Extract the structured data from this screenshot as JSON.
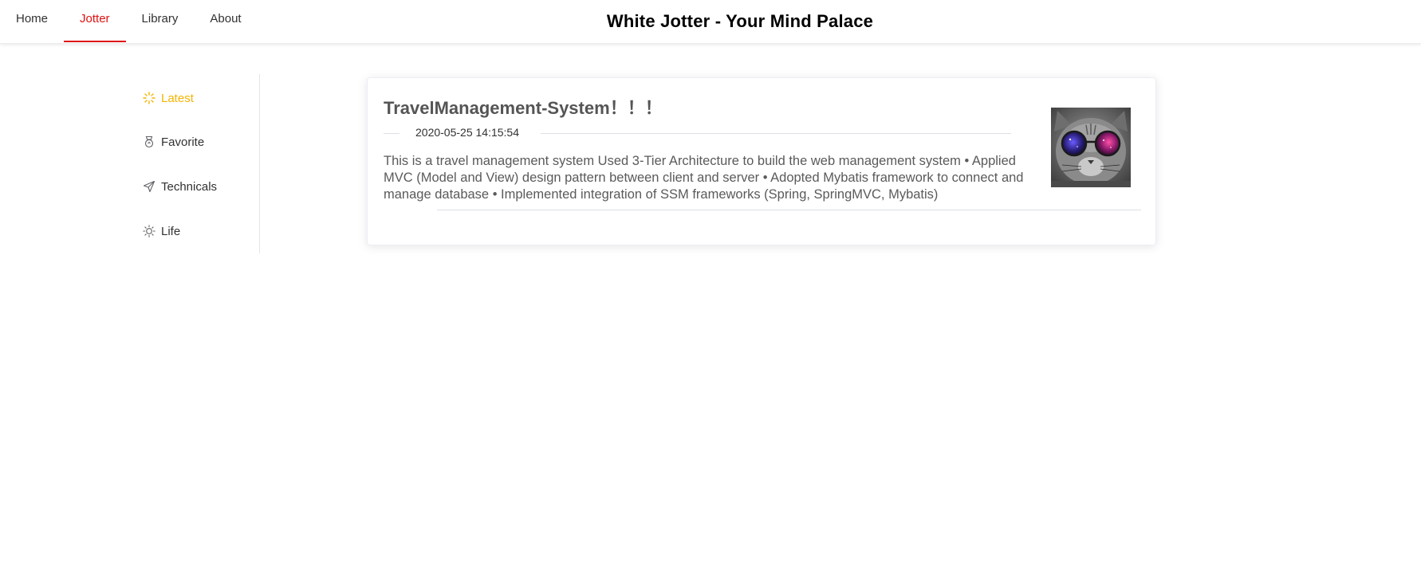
{
  "nav": {
    "items": [
      {
        "label": "Home",
        "active": false
      },
      {
        "label": "Jotter",
        "active": true
      },
      {
        "label": "Library",
        "active": false
      },
      {
        "label": "About",
        "active": false
      }
    ],
    "title": "White Jotter - Your Mind Palace"
  },
  "sidebar": {
    "items": [
      {
        "label": "Latest",
        "icon": "loading-icon",
        "active": true
      },
      {
        "label": "Favorite",
        "icon": "medal-icon",
        "active": false
      },
      {
        "label": "Technicals",
        "icon": "send-icon",
        "active": false
      },
      {
        "label": "Life",
        "icon": "sunny-icon",
        "active": false
      }
    ]
  },
  "article": {
    "title": "TravelManagement-System！！！",
    "date": "2020-05-25 14:15:54",
    "abstract": "This is a travel management system Used 3-Tier Architecture to build the web management system • Applied MVC (Model and View) design pattern between client and server • Adopted Mybatis framework to connect and manage database • Implemented integration of SSM frameworks (Spring, SpringMVC, Mybatis)",
    "thumbnail": "cat-with-galaxy-sunglasses-image"
  },
  "colors": {
    "nav_active": "#e01212",
    "sidebar_active": "#f5b400",
    "text": "#303133",
    "title_text": "#555555"
  }
}
